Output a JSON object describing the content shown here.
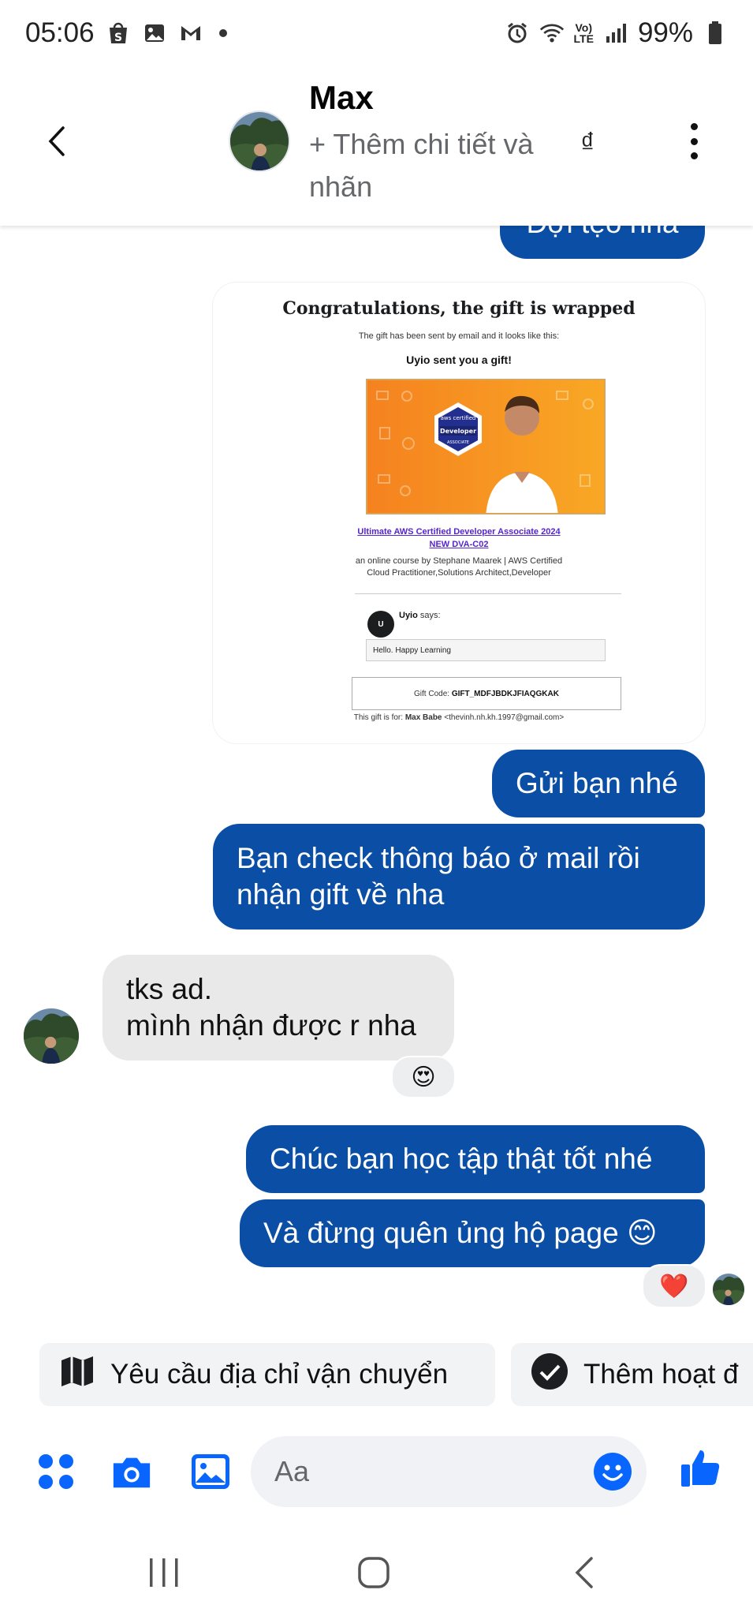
{
  "status_bar": {
    "time": "05:06",
    "battery": "99%",
    "volte_line1": "Vo)",
    "volte_line2": "LTE"
  },
  "header": {
    "contact_name": "Max",
    "subtitle": "+ Thêm chi tiết và nhãn",
    "currency_symbol": "₫"
  },
  "messages": {
    "partial_top": "Đợi tẹo nha",
    "gift_card": {
      "title": "Congratulations, the gift is wrapped",
      "sent_note": "The gift has been sent by email and it looks like this:",
      "sender_line": "Uyio sent you a gift!",
      "badge_brand": "aws certified",
      "badge_role": "Developer",
      "badge_level": "ASSOCIATE",
      "course_title_line1": "Ultimate AWS Certified Developer Associate 2024",
      "course_title_line2": "NEW DVA-C02",
      "course_by_line1": "an online course by Stephane Maarek | AWS Certified",
      "course_by_line2": "Cloud Practitioner,Solutions Architect,Developer",
      "sender_initial": "U",
      "sender_name": "Uyio",
      "says": "says:",
      "gift_message": "Hello. Happy Learning",
      "gift_code_label": "Gift Code:",
      "gift_code": "GIFT_MDFJBDKJFIAQGKAK",
      "gift_for_label": "This gift is for:",
      "gift_for_name": "Max Babe",
      "gift_for_email": "<thevinh.nh.kh.1997@gmail.com>"
    },
    "out1": "Gửi bạn nhé",
    "out2_line1": "Bạn check thông báo ở mail rồi",
    "out2_line2": "nhận gift về nha",
    "in1_line1": "tks ad.",
    "in1_line2": "mình nhận được r nha",
    "in1_reaction": "😍",
    "out3": "Chúc bạn học tập thật tốt nhé",
    "out4": "Và đừng quên ủng hộ page 😊",
    "out4_reaction": "❤️"
  },
  "quick_replies": {
    "shipping": "Yêu cầu địa chỉ vận chuyển",
    "activity": "Thêm hoạt đ"
  },
  "composer": {
    "placeholder": "Aa"
  },
  "colors": {
    "outgoing_bubble": "#0a4ea6",
    "incoming_bubble": "#e9e9ea",
    "accent": "#0866ff"
  }
}
